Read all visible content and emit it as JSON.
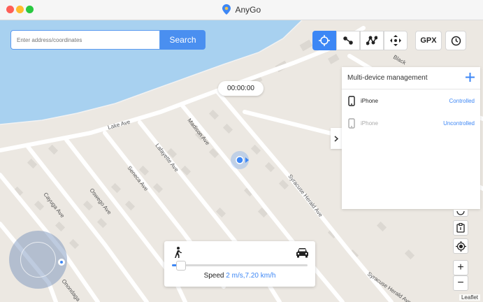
{
  "window": {
    "title": "AnyGo"
  },
  "search": {
    "placeholder": "Enter address/coordinates",
    "button_label": "Search"
  },
  "toolbar": {
    "modes": [
      {
        "name": "teleport-mode",
        "icon": "crosshair-icon",
        "active": true
      },
      {
        "name": "two-spot-mode",
        "icon": "two-spot-route-icon",
        "active": false
      },
      {
        "name": "multi-spot-mode",
        "icon": "multi-spot-route-icon",
        "active": false
      },
      {
        "name": "joystick-mode",
        "icon": "joystick-icon",
        "active": false
      }
    ],
    "gpx_label": "GPX",
    "history_icon": "clock-icon"
  },
  "timer": {
    "value": "00:00:00"
  },
  "map": {
    "streets": [
      "Lake Ave",
      "Madison Ave",
      "Lafayette Ave",
      "Seneca Ave",
      "Oswego Ave",
      "Cayuga Ave",
      "Onondaga",
      "Syracuse Herald Ave",
      "Black"
    ],
    "attribution": "Leaflet"
  },
  "devices_panel": {
    "title": "Multi-device management",
    "add_icon": "plus-icon",
    "devices": [
      {
        "name": "iPhone",
        "status": "Controlled",
        "icon": "phone-icon"
      },
      {
        "name": "iPhone",
        "status": "Uncontrolled",
        "icon": "phone-icon"
      }
    ]
  },
  "speed": {
    "label": "Speed",
    "value": "2 m/s,7.20 km/h",
    "slider_level": 0.06,
    "walk_icon": "walking-icon",
    "car_icon": "car-icon"
  },
  "controls": {
    "zoom_in": "+",
    "zoom_out": "−"
  },
  "colors": {
    "accent": "#3d87f5",
    "water": "#a8d1f0",
    "land": "#ece8e2"
  }
}
